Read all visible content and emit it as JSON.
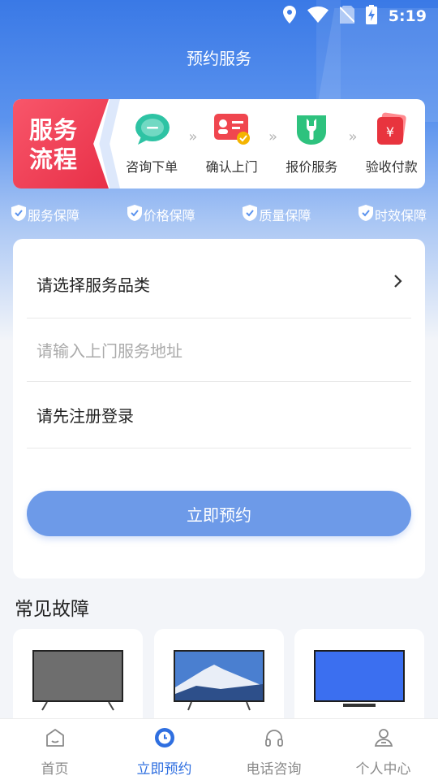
{
  "status_bar": {
    "time": "5:19",
    "icons": [
      "location-icon",
      "wifi-icon",
      "no-sim-icon",
      "battery-charging-icon"
    ]
  },
  "header": {
    "title": "预约服务"
  },
  "process": {
    "badge_line1": "服务",
    "badge_line2": "流程",
    "steps": [
      {
        "label": "咨询下单",
        "icon": "chat-icon",
        "color": "#2ec3a4"
      },
      {
        "label": "确认上门",
        "icon": "id-card-check-icon",
        "color": "#f0464f"
      },
      {
        "label": "报价服务",
        "icon": "wrench-icon",
        "color": "#2ec27e"
      },
      {
        "label": "验收付款",
        "icon": "wallet-yuan-icon",
        "color": "#e8343e"
      }
    ],
    "arrow": "»"
  },
  "guarantees": [
    "服务保障",
    "价格保障",
    "质量保障",
    "时效保障"
  ],
  "form": {
    "category_label": "请选择服务品类",
    "address_placeholder": "请输入上门服务地址",
    "login_label": "请先注册登录",
    "submit_label": "立即预约"
  },
  "faults": {
    "title": "常见故障",
    "items": [
      {
        "name": "tv-gray-screen",
        "screen_color": "#6e6e6e"
      },
      {
        "name": "tv-mountain-screen",
        "screen_color": "#4a7fd0"
      },
      {
        "name": "tv-blue-screen",
        "screen_color": "#3b6ff0"
      }
    ]
  },
  "nav": {
    "items": [
      {
        "label": "首页",
        "icon": "home-icon",
        "active": false
      },
      {
        "label": "立即预约",
        "icon": "clock-icon",
        "active": true
      },
      {
        "label": "电话咨询",
        "icon": "headphones-icon",
        "active": false
      },
      {
        "label": "个人中心",
        "icon": "user-icon",
        "active": false
      }
    ]
  },
  "colors": {
    "primary": "#2f6fe0",
    "button": "#6d9ae8",
    "badge": "#ee3a50"
  }
}
